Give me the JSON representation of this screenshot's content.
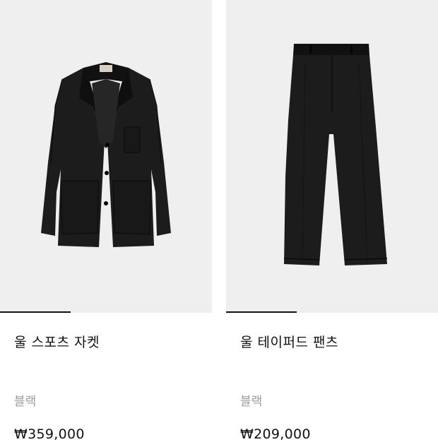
{
  "products": [
    {
      "name": "울 스포츠 자켓",
      "color": "블랙",
      "price": "₩359,000",
      "image_icon": "jacket-image",
      "garment_color": "#1a1a1a"
    },
    {
      "name": "울 테이퍼드 팬츠",
      "color": "블랙",
      "price": "₩209,000",
      "image_icon": "pants-image",
      "garment_color": "#1a1a1a"
    }
  ],
  "colors": {
    "image_bg": "#efefef",
    "indicator": "#111111",
    "muted_text": "#9a9a9a"
  }
}
